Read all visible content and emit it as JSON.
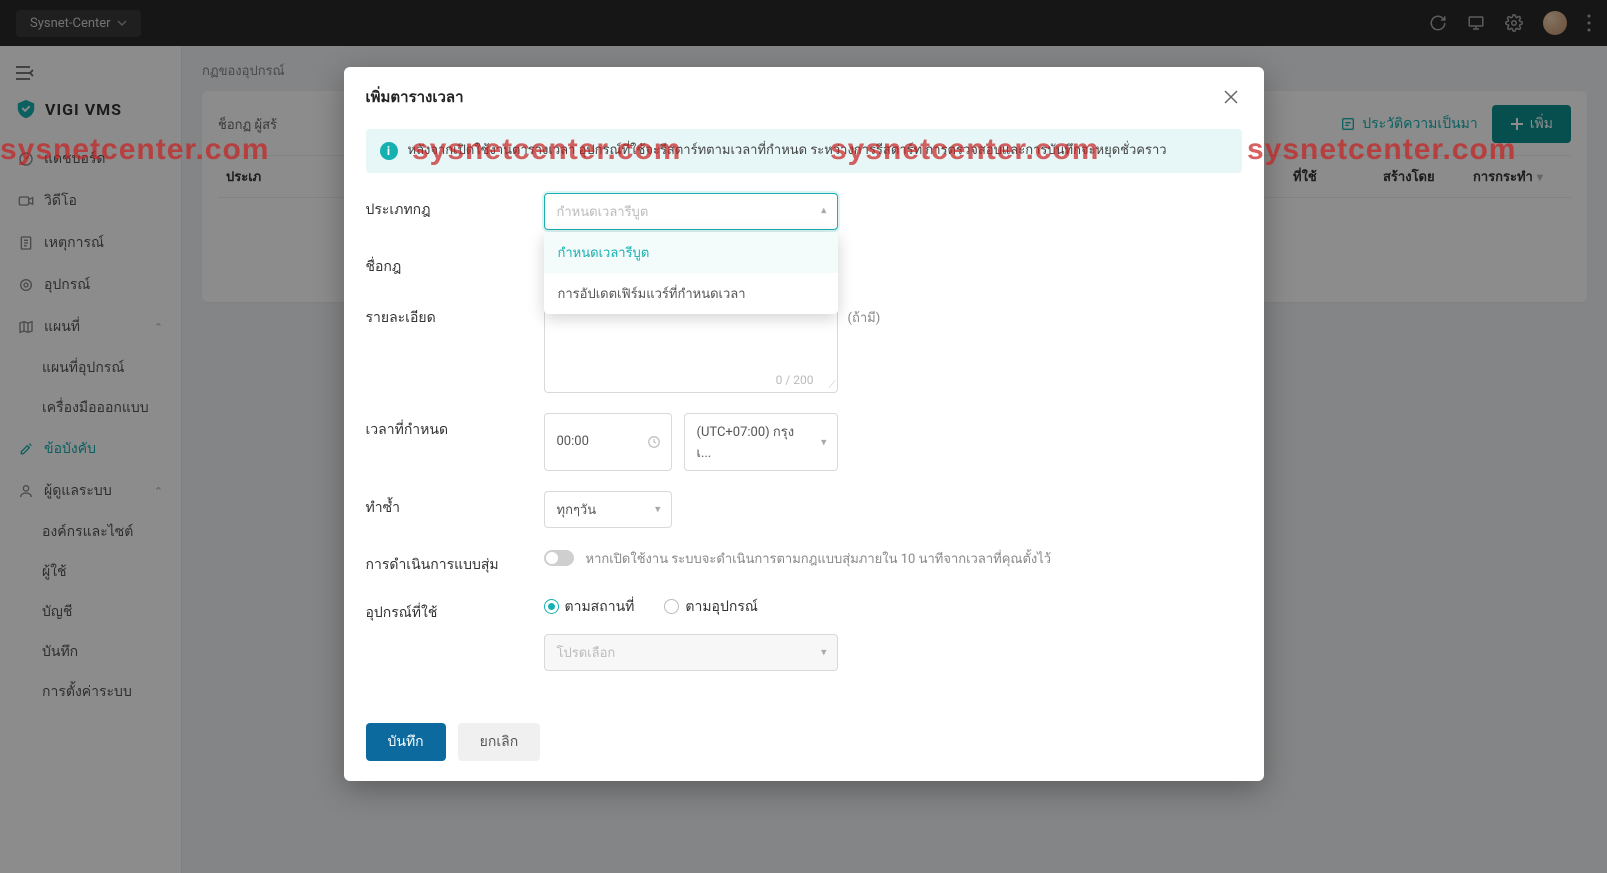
{
  "topbar": {
    "org": "Sysnet-Center"
  },
  "logo": {
    "text": "VIGI VMS"
  },
  "menu": {
    "dashboard": "แดชบอร์ด",
    "video": "วิดีโอ",
    "events": "เหตุการณ์",
    "devices": "อุปกรณ์",
    "maps": "แผนที่",
    "maps_sub": {
      "device_map": "แผนที่อุปกรณ์",
      "designer": "เครื่องมือออกแบบ"
    },
    "constraints": "ข้อบังคับ",
    "admin": "ผู้ดูแลระบบ",
    "admin_sub": {
      "org": "องค์กรและไซต์",
      "users": "ผู้ใช้",
      "accounts": "บัญชี",
      "save": "บันทึก",
      "system": "การตั้งค่าระบบ"
    }
  },
  "breadcrumb": "กฏของอุปกรณ์",
  "panel": {
    "left": "ช็อกฏ ผู้สร้",
    "history": "ประวัติความเป็นมา",
    "add": "เพิ่ม",
    "columns": {
      "type": "ประเภ",
      "applied": "ที่ใช้",
      "createdby": "สร้างโดย",
      "action": "การกระทำ"
    }
  },
  "modal": {
    "title": "เพิ่มตารางเวลา",
    "info": "หลังจากเปิดใช้งานตารางเวลา อุปกรณ์ที่ใช้จะรีสตาร์ทตามเวลาที่กำหนด ระหว่างการรีสตาร์ท การตรวจสอบและการบันทึกจะหยุดชั่วคราว",
    "labels": {
      "ruletype": "ประเภทกฎ",
      "rulename": "ชื่อกฎ",
      "desc": "รายละเอียด",
      "optional": "(ถ้ามี)",
      "schedtime": "เวลาที่กำหนด",
      "repeat": "ทำซ้ำ",
      "random": "การดำเนินการแบบสุ่ม",
      "applied": "อุปกรณ์ที่ใช้"
    },
    "ruletype_ph": "กำหนดเวลารีบูต",
    "ruletype_options": {
      "reboot": "กำหนดเวลารีบูต",
      "firmware": "การอัปเดตเฟิร์มแวร์ที่กำหนดเวลา"
    },
    "char_count": "0 / 200",
    "time_value": "00:00",
    "timezone": "(UTC+07:00) กรุงเ...",
    "repeat_value": "ทุกๆวัน",
    "random_desc": "หากเปิดใช้งาน ระบบจะดำเนินการตามกฎแบบสุ่มภายใน 10 นาทีจากเวลาที่คุณตั้งไว้",
    "applied_opts": {
      "location": "ตามสถานที่",
      "device": "ตามอุปกรณ์"
    },
    "select_ph": "โปรดเลือก",
    "save_btn": "บันทึก",
    "cancel_btn": "ยกเลิก"
  },
  "watermark": "sysnetcenter.com"
}
